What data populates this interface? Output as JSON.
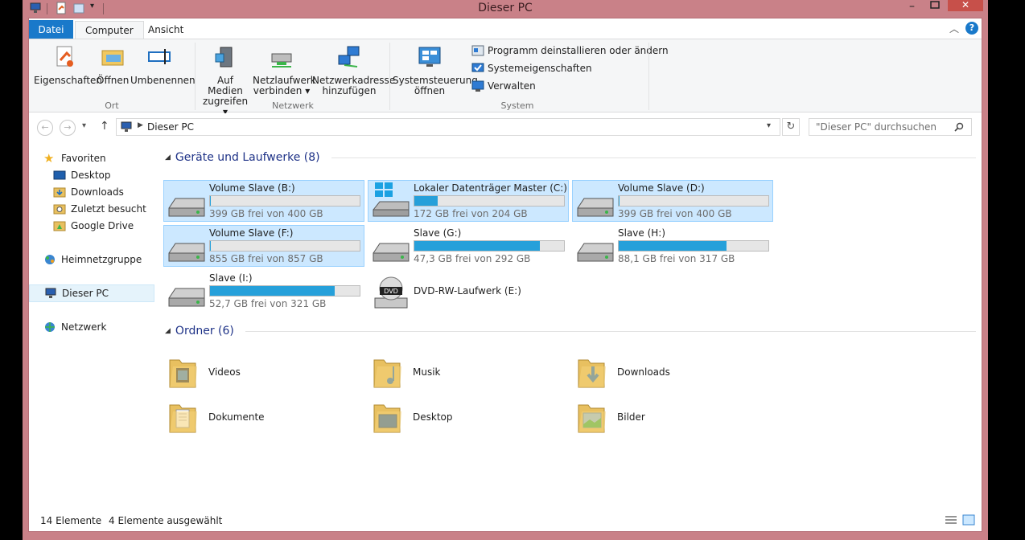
{
  "window": {
    "title": "Dieser PC"
  },
  "tabs": {
    "datei": "Datei",
    "computer": "Computer",
    "ansicht": "Ansicht"
  },
  "ribbon": {
    "ort": {
      "label": "Ort",
      "eigenschaften": "Eigenschaften",
      "oeffnen": "Öffnen",
      "umbenennen": "Umbenennen"
    },
    "netzwerk": {
      "label": "Netzwerk",
      "medien_l1": "Auf Medien",
      "medien_l2": "zugreifen",
      "laufwerk_l1": "Netzlaufwerk",
      "laufwerk_l2": "verbinden",
      "adresse_l1": "Netzwerkadresse",
      "adresse_l2": "hinzufügen"
    },
    "system": {
      "label": "System",
      "systemsteuerung_l1": "Systemsteuerung",
      "systemsteuerung_l2": "öffnen",
      "deinstallieren": "Programm deinstallieren oder ändern",
      "eigenschaften": "Systemeigenschaften",
      "verwalten": "Verwalten"
    }
  },
  "address": {
    "path": "Dieser PC",
    "search_placeholder": "\"Dieser PC\" durchsuchen"
  },
  "nav": {
    "favoriten": "Favoriten",
    "desktop": "Desktop",
    "downloads": "Downloads",
    "zuletzt": "Zuletzt besucht",
    "gdrive": "Google Drive",
    "heimnetz": "Heimnetzgruppe",
    "dieserpc": "Dieser PC",
    "netzwerk": "Netzwerk"
  },
  "sections": {
    "drives": "Geräte und Laufwerke (8)",
    "folders": "Ordner (6)"
  },
  "drives": [
    {
      "name": "Volume Slave (B:)",
      "free": "399 GB frei von 400 GB",
      "used": 0.0025,
      "selected": true
    },
    {
      "name": "Lokaler Datenträger Master (C:)",
      "free": "172 GB frei von 204 GB",
      "used": 0.157,
      "selected": true
    },
    {
      "name": "Volume Slave (D:)",
      "free": "399 GB frei von 400 GB",
      "used": 0.0025,
      "selected": true
    },
    {
      "name": "Volume Slave (F:)",
      "free": "855 GB frei von 857 GB",
      "used": 0.0023,
      "selected": true
    },
    {
      "name": "Slave (G:)",
      "free": "47,3 GB frei von 292 GB",
      "used": 0.838,
      "selected": false
    },
    {
      "name": "Slave  (H:)",
      "free": "88,1 GB frei von 317 GB",
      "used": 0.722,
      "selected": false
    },
    {
      "name": "Slave  (I:)",
      "free": "52,7 GB frei von 321 GB",
      "used": 0.836,
      "selected": false
    },
    {
      "name": "DVD-RW-Laufwerk (E:)"
    }
  ],
  "folders": [
    "Videos",
    "Musik",
    "Downloads",
    "Dokumente",
    "Desktop",
    "Bilder"
  ],
  "status": {
    "count": "14 Elemente",
    "selected": "4 Elemente ausgewählt"
  },
  "colors": {
    "accent": "#1979ca",
    "frame": "#c98188",
    "selection": "#cce8ff",
    "bar": "#26a0da"
  }
}
